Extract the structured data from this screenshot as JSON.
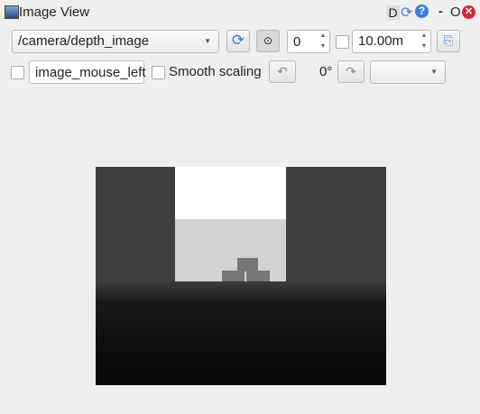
{
  "window": {
    "title": "Image View",
    "d_label": "D",
    "min_label": "-",
    "float_label": "O",
    "colors": {
      "close": "#d9262e",
      "accent": "#3a7fd5"
    }
  },
  "toolbar": {
    "topic": "/camera/depth_image",
    "zoom_value": "0",
    "max_depth": "10.00m",
    "mouse_topic": "image_mouse_left",
    "smooth_label": "Smooth scaling",
    "rotation": "0°",
    "color_select": ""
  }
}
